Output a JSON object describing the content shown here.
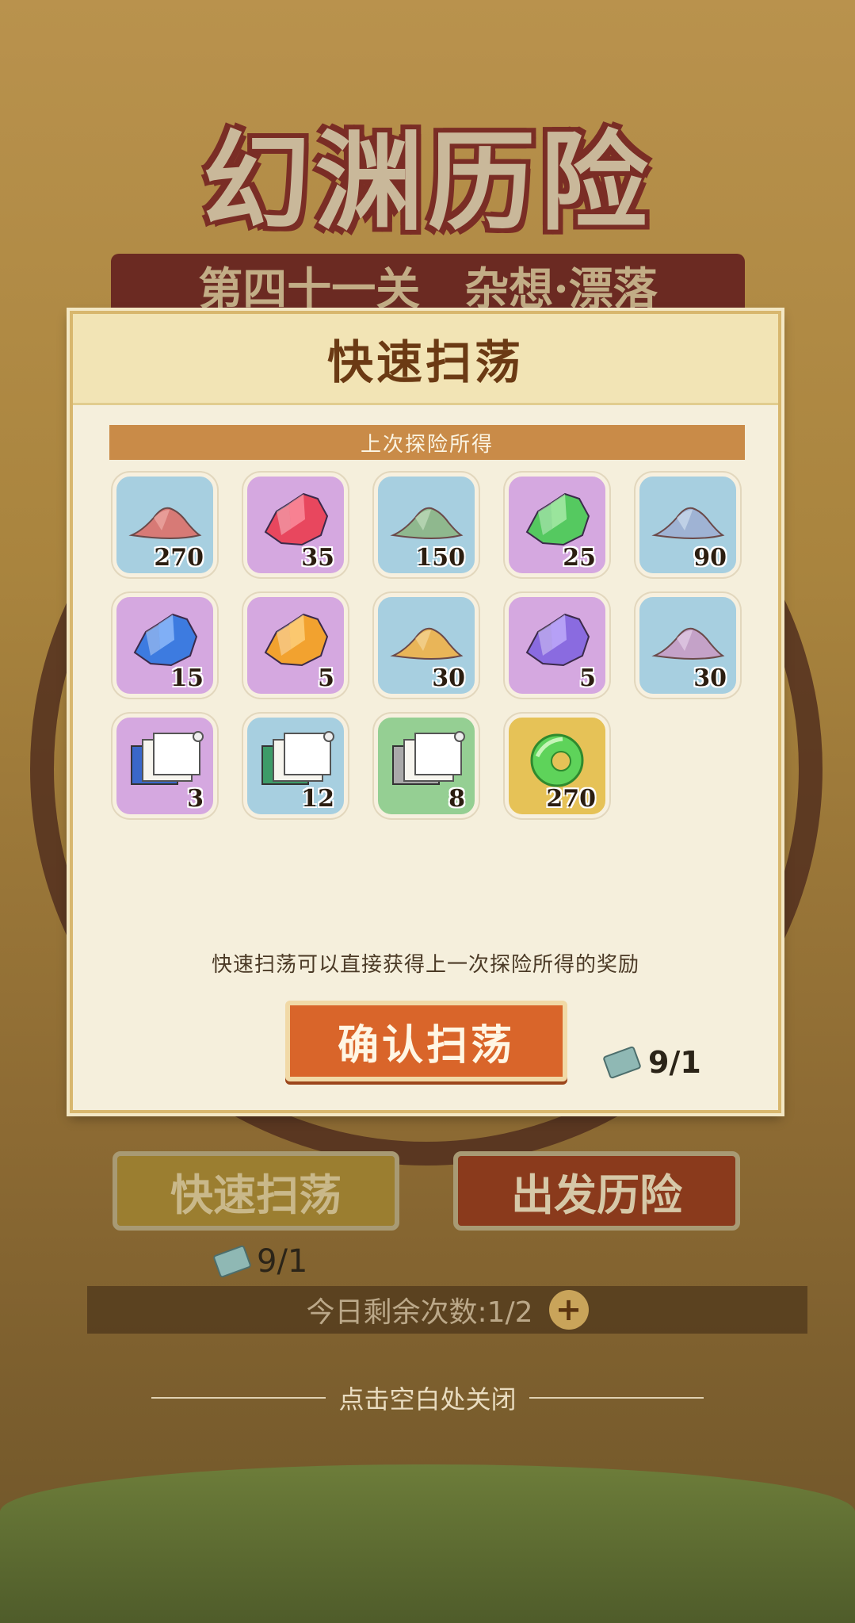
{
  "background": {
    "event_title": "幻渊历险",
    "level_banner": "第四十一关　杂想·漂落",
    "sweep_button": "快速扫荡",
    "depart_button": "出发历险",
    "ticket_count": "9/1",
    "remaining_label": "今日剩余次数:1/2",
    "close_hint": "点击空白处关闭"
  },
  "modal": {
    "title": "快速扫荡",
    "section_label": "上次探险所得",
    "items": [
      {
        "icon": "red-sand-icon",
        "count": "270",
        "bg": "blue"
      },
      {
        "icon": "red-crystal-icon",
        "count": "35",
        "bg": "purple"
      },
      {
        "icon": "green-sand-icon",
        "count": "150",
        "bg": "blue"
      },
      {
        "icon": "green-crystal-icon",
        "count": "25",
        "bg": "purple"
      },
      {
        "icon": "blue-sand-icon",
        "count": "90",
        "bg": "blue"
      },
      {
        "icon": "blue-crystal-icon",
        "count": "15",
        "bg": "purple"
      },
      {
        "icon": "orange-crystal-icon",
        "count": "5",
        "bg": "purple"
      },
      {
        "icon": "yellow-sand-icon",
        "count": "30",
        "bg": "blue"
      },
      {
        "icon": "violet-crystal-icon",
        "count": "5",
        "bg": "purple"
      },
      {
        "icon": "lilac-sand-icon",
        "count": "30",
        "bg": "blue"
      },
      {
        "icon": "blue-scroll-icon",
        "count": "3",
        "bg": "purple"
      },
      {
        "icon": "green-scroll-icon",
        "count": "12",
        "bg": "blue"
      },
      {
        "icon": "grey-scroll-icon",
        "count": "8",
        "bg": "green"
      },
      {
        "icon": "jade-ring-icon",
        "count": "270",
        "bg": "gold"
      }
    ],
    "description": "快速扫荡可以直接获得上一次探险所得的奖励",
    "confirm_button": "确认扫荡",
    "ticket_count": "9/1"
  },
  "colors": {
    "modal_bg": "#f5efdc",
    "section_bar": "#c98b48",
    "confirm_button": "#d9652a",
    "title_text": "#6b3a14"
  }
}
